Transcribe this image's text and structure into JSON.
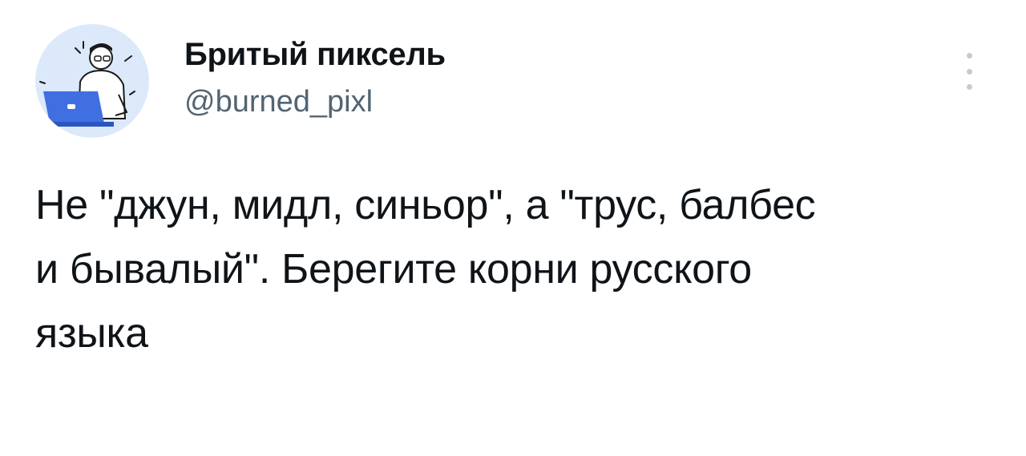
{
  "tweet": {
    "author": {
      "name": "Бритый пиксель",
      "handle": "@burned_pixl",
      "avatar_icon": "person-at-laptop-illustration"
    },
    "more_icon": "vertical-ellipsis-icon",
    "text_lines": [
      "Не \"джун, мидл, синьор\", а \"трус, балбес",
      "и бывалый\". Берегите корни русского",
      "языка"
    ]
  },
  "colors": {
    "avatar_bg": "#dbe9fb",
    "avatar_accent": "#3f6fe0",
    "handle": "#536471",
    "text": "#0f1419"
  }
}
